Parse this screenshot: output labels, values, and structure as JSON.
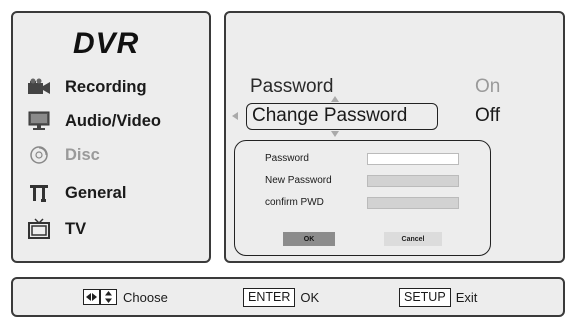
{
  "menu": {
    "title": "DVR",
    "items": [
      {
        "label": "Recording",
        "icon": "camera-icon",
        "dim": false
      },
      {
        "label": "Audio/Video",
        "icon": "monitor-icon",
        "dim": false
      },
      {
        "label": "Disc",
        "icon": "disc-icon",
        "dim": true
      },
      {
        "label": "General",
        "icon": "tools-icon",
        "dim": false
      },
      {
        "label": "TV",
        "icon": "tv-icon",
        "dim": false
      }
    ]
  },
  "options": {
    "password_label": "Password",
    "password_value": "On",
    "change_password_label": "Change Password",
    "change_password_value": "Off"
  },
  "dialog": {
    "password_label": "Password",
    "new_password_label": "New Password",
    "confirm_label": "confirm PWD",
    "password_value": "",
    "new_password_value": "",
    "confirm_value": "",
    "ok_label": "OK",
    "cancel_label": "Cancel"
  },
  "hints": {
    "choose_label": "Choose",
    "enter_key": "ENTER",
    "enter_label": "OK",
    "setup_key": "SETUP",
    "setup_label": "Exit"
  },
  "colors": {
    "panel_bg": "#ededed",
    "border": "#3a3a3a",
    "dim_text": "#9a9a9a",
    "input_active": "#ffffff",
    "input_inactive": "#d2d2d2",
    "ok_button": "#8c8c8c",
    "cancel_button": "#dcdcdc"
  }
}
